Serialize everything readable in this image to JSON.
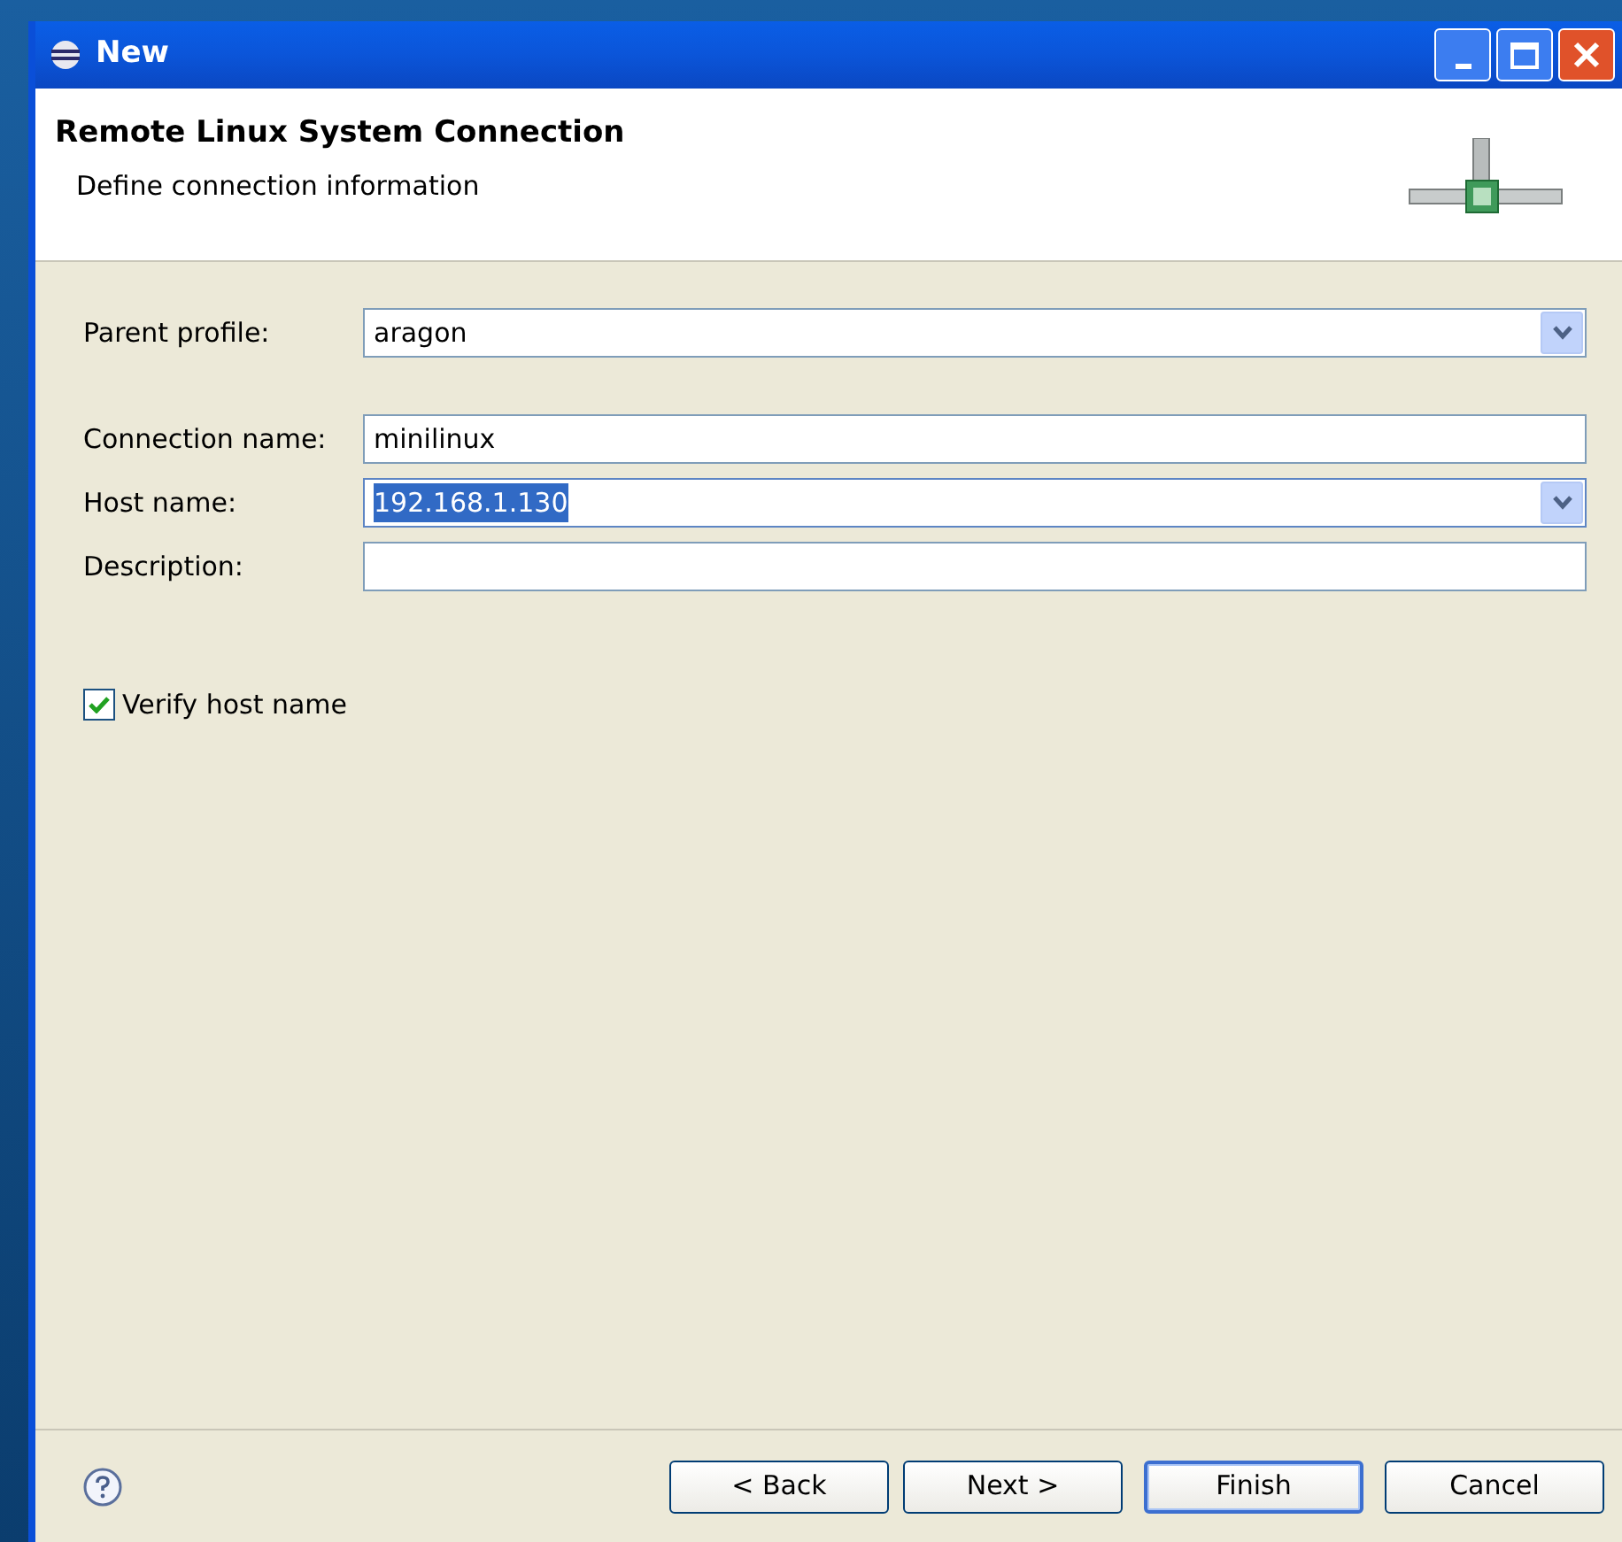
{
  "window": {
    "title": "New"
  },
  "header": {
    "title": "Remote Linux System Connection",
    "subtitle": "Define connection information"
  },
  "field_groups": [
    [
      {
        "label": "Parent profile:",
        "kind": "combo",
        "value": "aragon",
        "text_selected": false
      }
    ],
    [
      {
        "label": "Connection name:",
        "kind": "text",
        "value": "minilinux",
        "text_selected": false
      },
      {
        "label": "Host name:",
        "kind": "combo",
        "value": "192.168.1.130",
        "text_selected": true
      },
      {
        "label": "Description:",
        "kind": "text",
        "text_selected": false
      }
    ]
  ],
  "verify": {
    "label": "Verify host name",
    "checked": true
  },
  "buttons": [
    {
      "label": "< Back",
      "default": false
    },
    {
      "label": "Next >",
      "default": false
    },
    {
      "label": "Finish",
      "default": true
    },
    {
      "label": "Cancel",
      "default": false
    }
  ]
}
